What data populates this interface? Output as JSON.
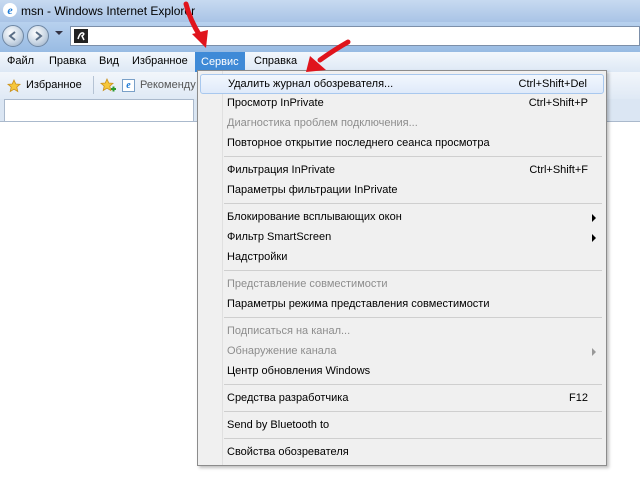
{
  "window": {
    "title": "msn - Windows Internet Explorer"
  },
  "menubar": {
    "items": [
      {
        "label": "Файл"
      },
      {
        "label": "Правка"
      },
      {
        "label": "Вид"
      },
      {
        "label": "Избранное"
      },
      {
        "label": "Сервис",
        "active": true
      },
      {
        "label": "Справка"
      }
    ]
  },
  "favorites": {
    "label": "Избранное",
    "link": "Рекоменду"
  },
  "dropdown": {
    "items": [
      {
        "label": "Удалить журнал обозревателя...",
        "shortcut": "Ctrl+Shift+Del"
      },
      {
        "label": "Просмотр InPrivate",
        "shortcut": "Ctrl+Shift+P"
      },
      {
        "label": "Диагностика проблем подключения..."
      },
      {
        "label": "Повторное открытие последнего сеанса просмотра"
      },
      {
        "label": "Фильтрация InPrivate",
        "shortcut": "Ctrl+Shift+F"
      },
      {
        "label": "Параметры фильтрации InPrivate"
      },
      {
        "label": "Блокирование всплывающих окон"
      },
      {
        "label": "Фильтр SmartScreen"
      },
      {
        "label": "Надстройки"
      },
      {
        "label": "Представление совместимости"
      },
      {
        "label": "Параметры режима представления совместимости"
      },
      {
        "label": "Подписаться на канал..."
      },
      {
        "label": "Обнаружение канала"
      },
      {
        "label": "Центр обновления Windows"
      },
      {
        "label": "Средства разработчика",
        "shortcut": "F12"
      },
      {
        "label": "Send by Bluetooth to"
      },
      {
        "label": "Свойства обозревателя"
      }
    ]
  },
  "icons": {
    "ie_logo": "ie-logo-icon",
    "back": "back-arrow-icon",
    "forward": "forward-arrow-icon",
    "favorites_star": "favorites-star-icon",
    "add_favorite": "add-favorite-icon",
    "annotation": "red-arrow-icon"
  },
  "colors": {
    "menu_active": "#3f8ad7",
    "annotation_red": "#e0141c",
    "disabled_text": "#8d8d8d"
  }
}
